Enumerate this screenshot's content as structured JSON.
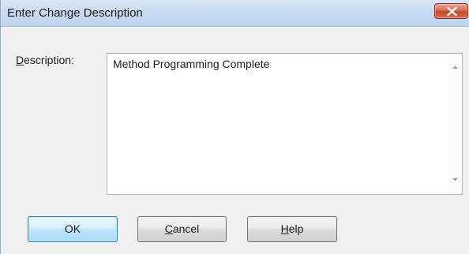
{
  "window": {
    "title": "Enter Change Description",
    "close_icon": "close-x-icon",
    "close_color": "#c4472c"
  },
  "form": {
    "description_label_mnemonic": "D",
    "description_label_rest": "escription:",
    "description_value": "Method Programming Complete",
    "scroll_up_icon": "scroll-up-arrow-icon",
    "scroll_down_icon": "scroll-down-arrow-icon"
  },
  "buttons": {
    "ok_label": "OK",
    "cancel_mnemonic": "C",
    "cancel_rest": "ancel",
    "help_mnemonic": "H",
    "help_rest": "elp",
    "default_button_accent": "#3c7fb1"
  }
}
